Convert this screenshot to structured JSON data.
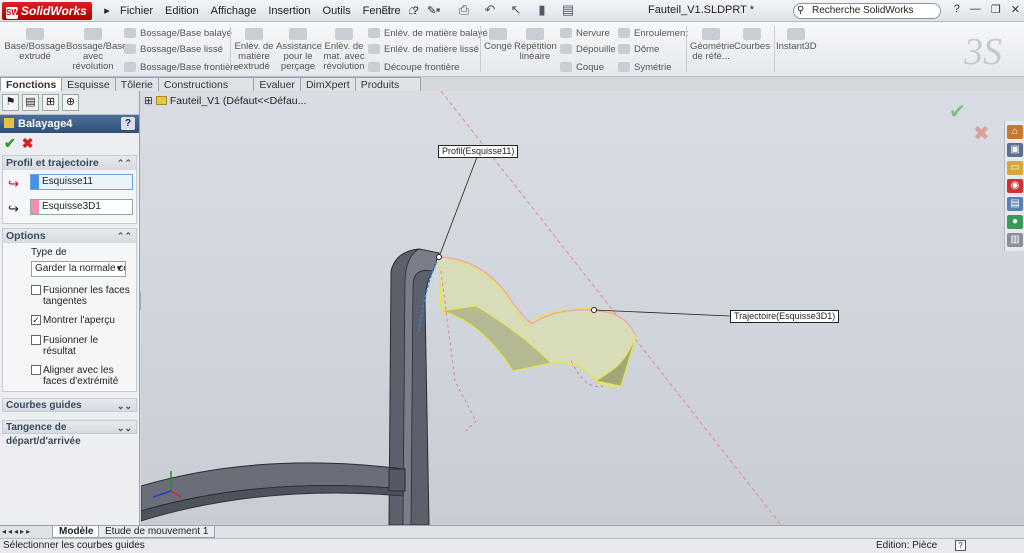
{
  "app": {
    "brand": "SolidWorks",
    "doc_title": "Fauteil_V1.SLDPRT *",
    "search_placeholder": "Recherche SolidWorks"
  },
  "menu": [
    "Fichier",
    "Edition",
    "Affichage",
    "Insertion",
    "Outils",
    "Fenêtre",
    "?"
  ],
  "ribbon": {
    "base_extrude": "Base/Bossage extrudé",
    "revolve": "Bossage/Base avec révolution",
    "swept": "Bossage/Base balayé",
    "loft": "Bossage/Base lissé",
    "boundary": "Bossage/Base frontière",
    "cut_extrude": "Enlèv. de matière extrudé",
    "hole_wizard": "Assistance pour le perçage",
    "cut_revolve": "Enlèv. de mat. avec révolution",
    "cut_swept": "Enlèv. de matière balayé",
    "cut_loft": "Enlèv. de matière lissé",
    "cut_boundary": "Découpe frontière",
    "fillet": "Congé",
    "pattern": "Répétition linéaire",
    "rib": "Nervure",
    "draft": "Dépouille",
    "shell": "Coque",
    "wrap": "Enroulement",
    "dome": "Dôme",
    "mirror": "Symétrie",
    "ref_geom": "Géométrie de réfé...",
    "curves": "Courbes",
    "instant3d": "Instant3D"
  },
  "tabs": [
    "Fonctions",
    "Esquisse",
    "Tôlerie",
    "Constructions soudées",
    "Evaluer",
    "DimXpert",
    "Produits Office"
  ],
  "feature_manager": {
    "feature_title": "Balayage4",
    "help": "?",
    "profile_group": "Profil et trajectoire",
    "profile_value": "Esquisse11",
    "path_value": "Esquisse3D1",
    "options_group": "Options",
    "orientation_label": "Type de",
    "orientation_value": "Garder la normale cor",
    "cb_merge_tangent": "Fusionner les faces tangentes",
    "cb_show_preview": "Montrer l'aperçu",
    "cb_merge_result": "Fusionner le résultat",
    "cb_align_end": "Aligner avec les faces d'extrémité",
    "guide_curves": "Courbes guides",
    "tangency": "Tangence de départ/d'arrivée"
  },
  "tree": {
    "item": "Fauteil_V1  (Défaut<<Défau..."
  },
  "callouts": {
    "profile": "Profil(Esquisse11)",
    "path": "Trajectoire(Esquisse3D1)"
  },
  "bottom_tabs": {
    "model": "Modèle",
    "motion": "Etude de mouvement 1"
  },
  "status": {
    "message": "Sélectionner les courbes guides",
    "mode": "Edition: Pièce",
    "help": "?"
  },
  "colors": {
    "profile_swatch": "#4a90e2",
    "path_swatch": "#f48fb1",
    "accent": "#2e4f78"
  }
}
